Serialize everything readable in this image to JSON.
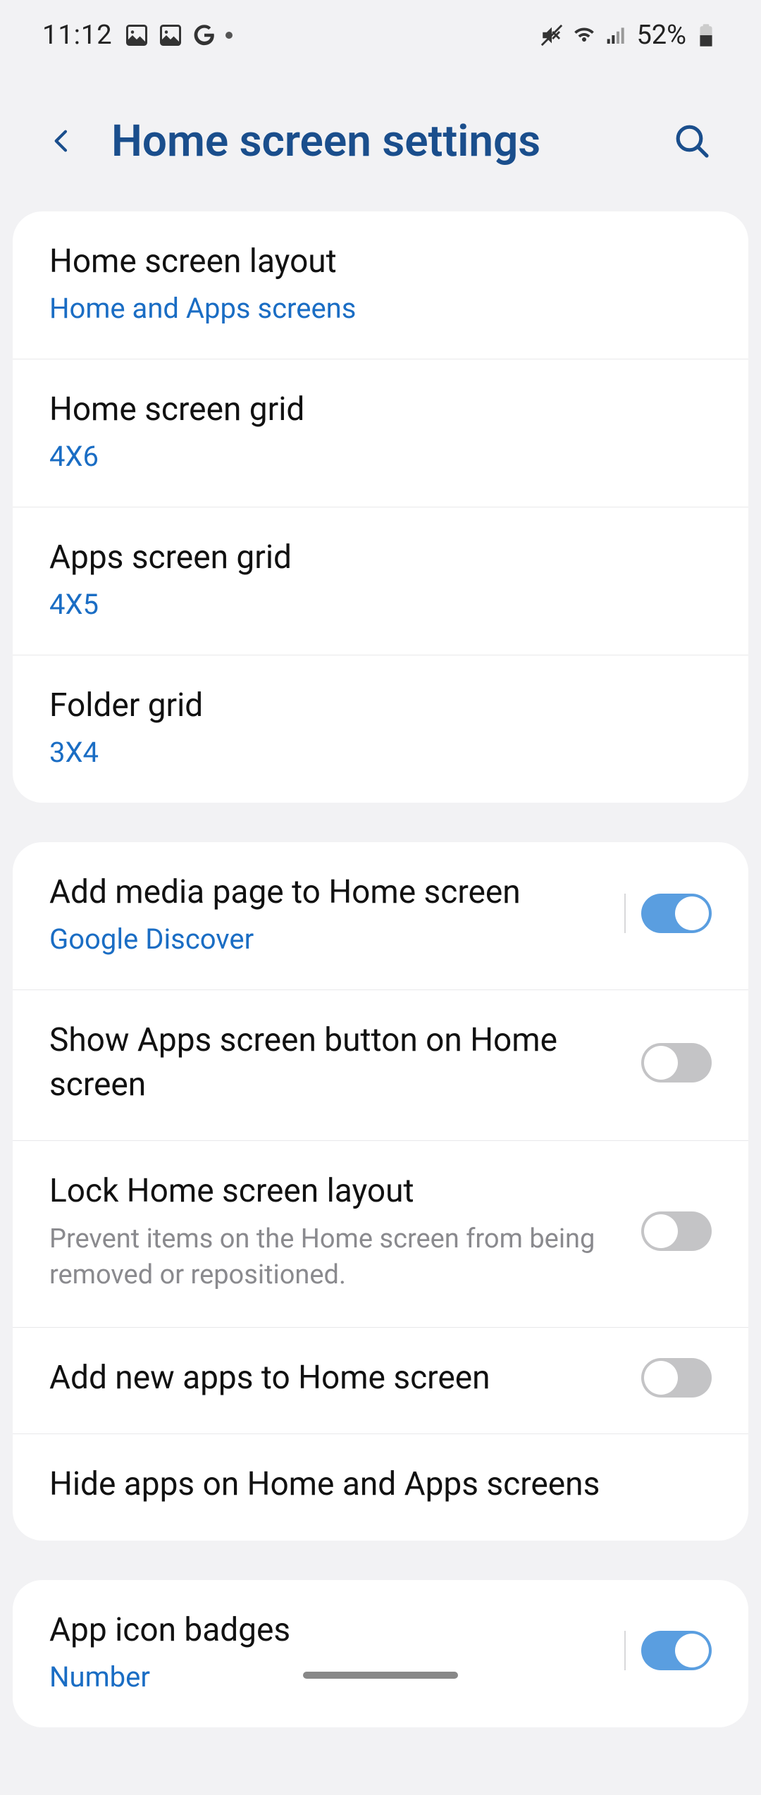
{
  "status_bar": {
    "time": "11:12",
    "battery_pct": "52%"
  },
  "header": {
    "title": "Home screen settings"
  },
  "group1": [
    {
      "title": "Home screen layout",
      "sub": "Home and Apps screens"
    },
    {
      "title": "Home screen grid",
      "sub": "4X6"
    },
    {
      "title": "Apps screen grid",
      "sub": "4X5"
    },
    {
      "title": "Folder grid",
      "sub": "3X4"
    }
  ],
  "group2": [
    {
      "title": "Add media page to Home screen",
      "sub": "Google Discover",
      "toggle": "on",
      "has_divider": true
    },
    {
      "title": "Show Apps screen button on Home screen",
      "toggle": "off"
    },
    {
      "title": "Lock Home screen layout",
      "desc": "Prevent items on the Home screen from being removed or repositioned.",
      "toggle": "off"
    },
    {
      "title": "Add new apps to Home screen",
      "toggle": "off"
    },
    {
      "title": "Hide apps on Home and Apps screens"
    }
  ],
  "group3": [
    {
      "title": "App icon badges",
      "sub": "Number",
      "toggle": "on",
      "has_divider": true
    }
  ]
}
